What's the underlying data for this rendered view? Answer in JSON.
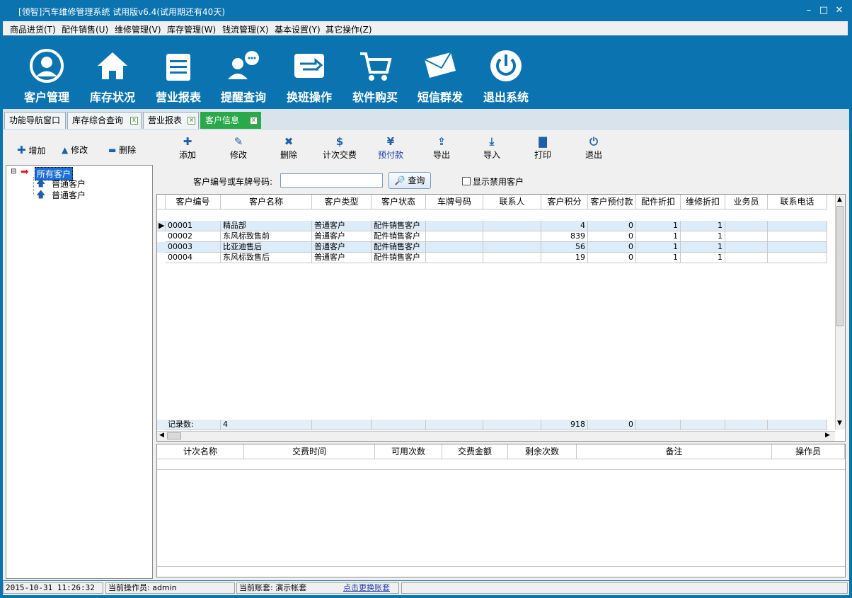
{
  "window": {
    "title": "[领智]汽车维修管理系统 试用版v6.4(试用期还有40天)",
    "min": "–",
    "max": "□",
    "close": "✕"
  },
  "menu": [
    "商品进货(T)",
    "配件销售(U)",
    "维修管理(V)",
    "库存管理(W)",
    "钱流管理(X)",
    "基本设置(Y)",
    "其它操作(Z)"
  ],
  "big_buttons": [
    "客户管理",
    "库存状况",
    "营业报表",
    "提醒查询",
    "换班操作",
    "软件购买",
    "短信群发",
    "退出系统"
  ],
  "tabs": [
    "功能导航窗口",
    "库存综合查询",
    "营业报表",
    "客户信息"
  ],
  "tab_close": "x",
  "left_toolbar": [
    "增加",
    "修改",
    "删除"
  ],
  "toolbar": [
    "添加",
    "修改",
    "删除",
    "计次交费",
    "预付款",
    "导出",
    "导入",
    "打印",
    "退出"
  ],
  "tree": {
    "root": "所有客户",
    "children": [
      "普通客户",
      "普通客户"
    ],
    "expander": "⊟"
  },
  "search": {
    "label": "客户编号或车牌号码:",
    "value": "",
    "button": "查询",
    "checkbox_label": "显示禁用客户"
  },
  "grid": {
    "columns": [
      "客户编号",
      "客户名称",
      "客户类型",
      "客户状态",
      "车牌号码",
      "联系人",
      "客户积分",
      "客户预付款",
      "配件折扣",
      "维修折扣",
      "业务员",
      "联系电话"
    ],
    "rows": [
      [
        "00001",
        "精品部",
        "普通客户",
        "配件销售客户",
        "",
        "",
        "4",
        "0",
        "1",
        "1",
        "",
        ""
      ],
      [
        "00002",
        "东风标致售前",
        "普通客户",
        "配件销售客户",
        "",
        "",
        "839",
        "0",
        "1",
        "1",
        "",
        ""
      ],
      [
        "00003",
        "比亚迪售后",
        "普通客户",
        "配件销售客户",
        "",
        "",
        "56",
        "0",
        "1",
        "1",
        "",
        ""
      ],
      [
        "00004",
        "东风标致售后",
        "普通客户",
        "配件销售客户",
        "",
        "",
        "19",
        "0",
        "1",
        "1",
        "",
        ""
      ]
    ],
    "summary": {
      "label": "记录数:",
      "count": "4",
      "points": "918",
      "prepay": "0"
    }
  },
  "grid2": {
    "columns": [
      "计次名称",
      "交费时间",
      "可用次数",
      "交费金额",
      "剩余次数",
      "备注",
      "操作员"
    ]
  },
  "status": {
    "datetime": "2015-10-31 11:26:32",
    "operator": "当前操作员: admin",
    "account": "当前账套: 演示帐套",
    "switch_link": "点击更换账套"
  }
}
